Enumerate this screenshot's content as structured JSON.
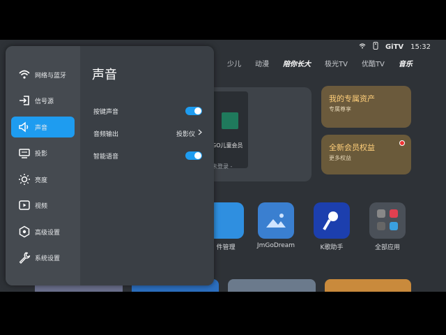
{
  "status": {
    "time": "15:32",
    "logo": "GiTV"
  },
  "nav_tabs": [
    "少儿",
    "动漫",
    "陪你长大",
    "极光TV",
    "优酷TV",
    "音乐"
  ],
  "background": {
    "vip_card": {
      "title": "GO儿童会员",
      "subtitle": "未登录 -"
    },
    "asset_card": {
      "title": "我的专属资产",
      "subtitle": "专属尊享"
    },
    "benefit_card": {
      "title": "全新会员权益",
      "subtitle": "更多权益"
    },
    "apps": [
      "件管理",
      "JmGoDream",
      "K歌助手",
      "全部应用"
    ]
  },
  "sidebar": {
    "items": [
      {
        "label": "网络与蓝牙",
        "icon": "wifi-icon"
      },
      {
        "label": "信号源",
        "icon": "input-source-icon"
      },
      {
        "label": "声音",
        "icon": "speaker-icon"
      },
      {
        "label": "投影",
        "icon": "projector-icon"
      },
      {
        "label": "亮度",
        "icon": "brightness-icon"
      },
      {
        "label": "视频",
        "icon": "video-icon"
      },
      {
        "label": "高级设置",
        "icon": "advanced-settings-icon"
      },
      {
        "label": "系统设置",
        "icon": "wrench-icon"
      }
    ],
    "active_index": 2
  },
  "sound": {
    "title": "声音",
    "key_sound": {
      "label": "按键声音",
      "enabled": true
    },
    "audio_output": {
      "label": "音频输出",
      "value": "投影仪"
    },
    "smart_voice": {
      "label": "智能语音",
      "enabled": true
    }
  },
  "colors": {
    "accent": "#1e9cf0",
    "gold": "#ffcf7a"
  }
}
